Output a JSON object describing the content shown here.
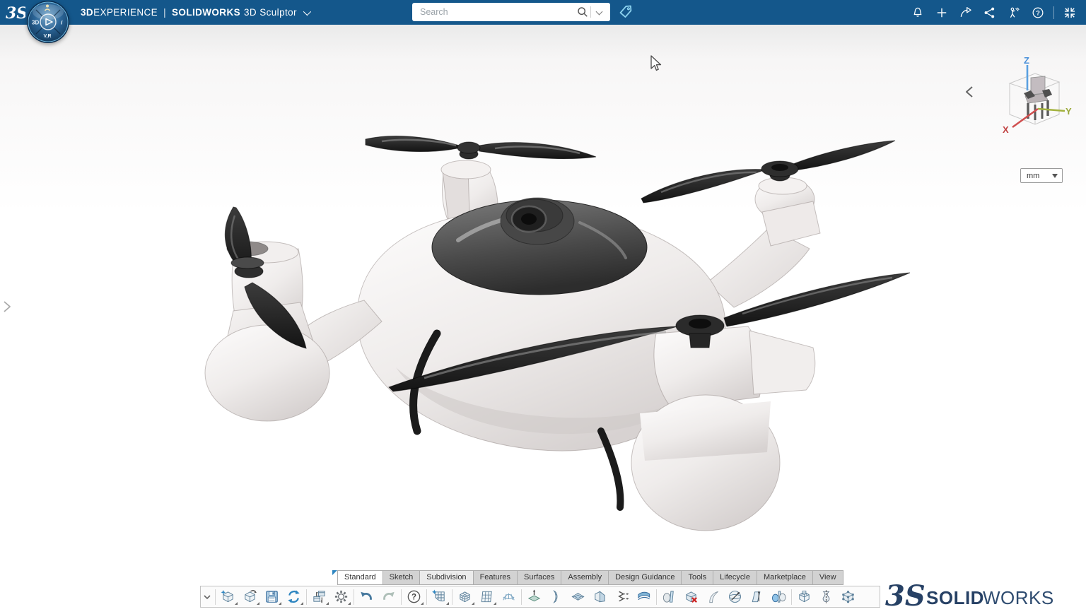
{
  "colors": {
    "topbar": "#14578B",
    "accent": "#2e86c1",
    "tag": "#8ed4f0",
    "axis_x": "#c04040",
    "axis_y": "#9aa83a",
    "axis_z": "#4a90d9",
    "watermark": "#1f3a5f"
  },
  "titlebar": {
    "ds_logo": "3S",
    "brand_bold": "3D",
    "brand_rest": "EXPERIENCE",
    "divider": "|",
    "product": "SOLIDWORKS",
    "app": "3D Sculptor",
    "icons": [
      {
        "name": "notifications-bell-icon"
      },
      {
        "name": "add-content-icon"
      },
      {
        "name": "share-forward-icon"
      },
      {
        "name": "share-network-icon"
      },
      {
        "name": "assistance-icon"
      },
      {
        "name": "help-icon"
      },
      {
        "name": "divider"
      },
      {
        "name": "exit-fullscreen-icon"
      }
    ]
  },
  "compass": {
    "west_label": "3D",
    "south_label": "V,R",
    "east_label": "i",
    "center": "play",
    "north": "user-icon"
  },
  "search": {
    "placeholder": "Search",
    "magnifier": "search-icon",
    "dropdown": "chevron-down-icon",
    "tag": "tag-icon"
  },
  "viewport": {
    "expander": "chevron-right-icon",
    "model": "drone-quadcopter-render",
    "cursor": "mouse-pointer"
  },
  "viewcube": {
    "collapse": "chevron-left-icon",
    "axis_x": "X",
    "axis_y": "Y",
    "axis_z": "Z",
    "units_value": "mm"
  },
  "tabs": {
    "items": [
      {
        "label": "Standard",
        "state": "active"
      },
      {
        "label": "Sketch",
        "state": ""
      },
      {
        "label": "Subdivision",
        "state": "highlight"
      },
      {
        "label": "Features",
        "state": ""
      },
      {
        "label": "Surfaces",
        "state": ""
      },
      {
        "label": "Assembly",
        "state": ""
      },
      {
        "label": "Design Guidance",
        "state": ""
      },
      {
        "label": "Tools",
        "state": ""
      },
      {
        "label": "Lifecycle",
        "state": ""
      },
      {
        "label": "Marketplace",
        "state": ""
      },
      {
        "label": "View",
        "state": ""
      }
    ]
  },
  "toolbar": {
    "expander": "chevron-down-icon",
    "groups": [
      [
        {
          "name": "new-part",
          "fly": true
        },
        {
          "name": "open-part",
          "fly": true
        },
        {
          "name": "save",
          "fly": true
        },
        {
          "name": "sync-update",
          "fly": true
        }
      ],
      [
        {
          "name": "transfer-content",
          "fly": true
        },
        {
          "name": "options-gear",
          "fly": true
        }
      ],
      [
        {
          "name": "undo",
          "fly": false
        },
        {
          "name": "redo",
          "fly": false
        }
      ],
      [
        {
          "name": "help-question",
          "fly": true
        }
      ],
      [
        {
          "name": "convert-to-subdivision",
          "fly": true
        }
      ],
      [
        {
          "name": "subdivision-box",
          "fly": true
        },
        {
          "name": "subdivision-plane",
          "fly": true
        },
        {
          "name": "subdivision-mesh",
          "fly": false
        }
      ],
      [
        {
          "name": "pull-face",
          "fly": false
        },
        {
          "name": "bend-surface",
          "fly": false
        },
        {
          "name": "inset-face",
          "fly": false
        },
        {
          "name": "crease-edges",
          "fly": false
        },
        {
          "name": "match-edges",
          "fly": false
        },
        {
          "name": "thicken-surface",
          "fly": false
        }
      ],
      [
        {
          "name": "mirror-trim",
          "fly": false
        },
        {
          "name": "delete-body",
          "fly": false
        },
        {
          "name": "flex-bend",
          "fly": false
        },
        {
          "name": "sphere-deform",
          "fly": false
        },
        {
          "name": "shear-face",
          "fly": false
        },
        {
          "name": "mirror-copy",
          "fly": false
        }
      ],
      [
        {
          "name": "combine-bodies",
          "fly": false
        },
        {
          "name": "symmetry-body",
          "fly": false
        },
        {
          "name": "control-cage",
          "fly": false
        }
      ]
    ]
  },
  "watermark": {
    "logo": "3S",
    "brand_bold": "SOLID",
    "brand_light": "WORKS"
  }
}
